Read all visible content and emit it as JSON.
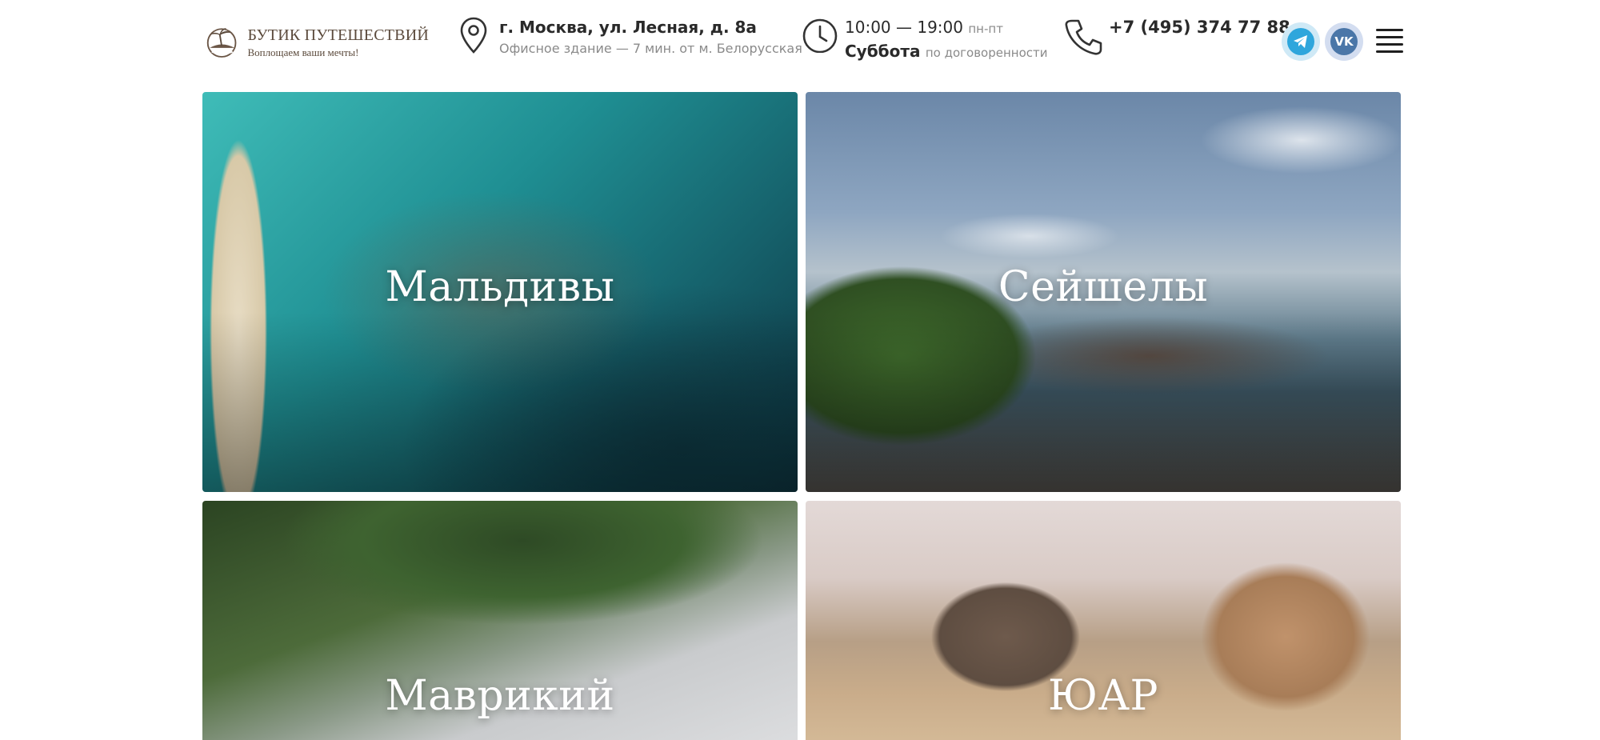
{
  "brand": {
    "title": "БУТИК ПУТЕШЕСТВИЙ",
    "tagline": "Воплощаем ваши мечты!"
  },
  "contacts": {
    "address_main": "г. Москва, ул. Лесная, д. 8а",
    "address_sub": "Офисное здание — 7 мин. от м. Белорусская",
    "hours_time": "10:00 — 19:00",
    "hours_days": "пн-пт",
    "saturday_label": "Суббота",
    "saturday_note": "по договоренности",
    "phone": "+7 (495) 374 77 88"
  },
  "social": {
    "vk_text": "VK"
  },
  "destinations": [
    {
      "label": "Мальдивы"
    },
    {
      "label": "Сейшелы"
    },
    {
      "label": "Маврикий"
    },
    {
      "label": "ЮАР"
    }
  ],
  "colors": {
    "telegram": "#2ea6dc",
    "vk": "#4a76a8",
    "brand_brown": "#5b4a3c"
  },
  "icons": {
    "logo": "palm-sun-logo",
    "address": "location-pin-icon",
    "hours": "clock-icon",
    "phone": "phone-icon",
    "telegram": "telegram-icon",
    "vk": "vk-icon",
    "menu": "hamburger-menu-icon"
  }
}
